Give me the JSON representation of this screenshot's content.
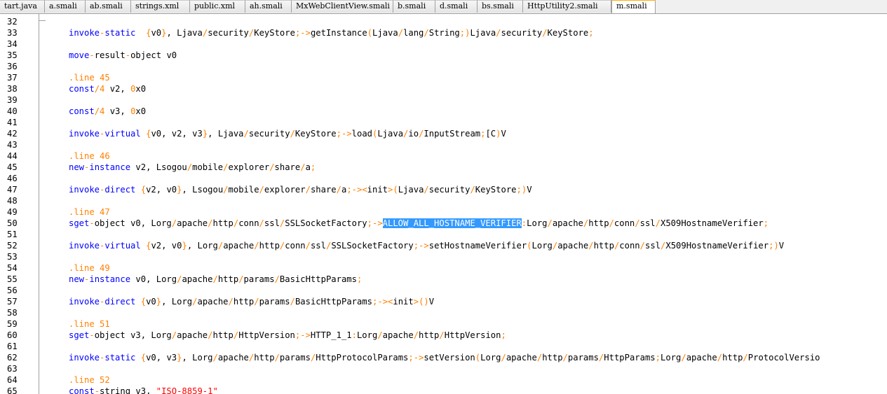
{
  "tabs": [
    {
      "label": "tart.java",
      "active": false
    },
    {
      "label": "a.smali",
      "active": false
    },
    {
      "label": "ab.smali",
      "active": false
    },
    {
      "label": "strings.xml",
      "active": false
    },
    {
      "label": "public.xml",
      "active": false
    },
    {
      "label": "ah.smali",
      "active": false
    },
    {
      "label": "MxWebClientView.smali",
      "active": false
    },
    {
      "label": "b.smali",
      "active": false
    },
    {
      "label": "d.smali",
      "active": false
    },
    {
      "label": "bs.smali",
      "active": false
    },
    {
      "label": "HttpUtility2.smali",
      "active": false
    },
    {
      "label": "m.smali",
      "active": true
    }
  ],
  "selection": "ALLOW_ALL_HOSTNAME_VERIFIER",
  "lines": [
    {
      "n": "32",
      "tokens": []
    },
    {
      "n": "33",
      "tokens": [
        [
          "kw",
          "invoke"
        ],
        [
          "op",
          "-"
        ],
        [
          "kw",
          "static"
        ],
        [
          "",
          "  "
        ],
        [
          "op",
          "{"
        ],
        [
          "",
          "v0"
        ],
        [
          "op",
          "}"
        ],
        [
          "",
          ", Ljava"
        ],
        [
          "op",
          "/"
        ],
        [
          "",
          "security"
        ],
        [
          "op",
          "/"
        ],
        [
          "",
          "KeyStore"
        ],
        [
          "op",
          ";->"
        ],
        [
          "",
          "getInstance"
        ],
        [
          "op",
          "("
        ],
        [
          "",
          "Ljava"
        ],
        [
          "op",
          "/"
        ],
        [
          "",
          "lang"
        ],
        [
          "op",
          "/"
        ],
        [
          "",
          "String"
        ],
        [
          "op",
          ";)"
        ],
        [
          "",
          "Ljava"
        ],
        [
          "op",
          "/"
        ],
        [
          "",
          "security"
        ],
        [
          "op",
          "/"
        ],
        [
          "",
          "KeyStore"
        ],
        [
          "op",
          ";"
        ]
      ]
    },
    {
      "n": "34",
      "tokens": []
    },
    {
      "n": "35",
      "tokens": [
        [
          "kw",
          "move"
        ],
        [
          "op",
          "-"
        ],
        [
          "",
          "result"
        ],
        [
          "op",
          "-"
        ],
        [
          "",
          "object v0"
        ]
      ]
    },
    {
      "n": "36",
      "tokens": []
    },
    {
      "n": "37",
      "tokens": [
        [
          "dir",
          ".line"
        ],
        [
          "",
          " "
        ],
        [
          "num",
          "45"
        ]
      ]
    },
    {
      "n": "38",
      "tokens": [
        [
          "kw",
          "const"
        ],
        [
          "op",
          "/"
        ],
        [
          "num",
          "4"
        ],
        [
          "",
          " v2, "
        ],
        [
          "num",
          "0"
        ],
        [
          "",
          "x0"
        ]
      ]
    },
    {
      "n": "39",
      "tokens": []
    },
    {
      "n": "40",
      "tokens": [
        [
          "kw",
          "const"
        ],
        [
          "op",
          "/"
        ],
        [
          "num",
          "4"
        ],
        [
          "",
          " v3, "
        ],
        [
          "num",
          "0"
        ],
        [
          "",
          "x0"
        ]
      ]
    },
    {
      "n": "41",
      "tokens": []
    },
    {
      "n": "42",
      "tokens": [
        [
          "kw",
          "invoke"
        ],
        [
          "op",
          "-"
        ],
        [
          "kw",
          "virtual"
        ],
        [
          "",
          " "
        ],
        [
          "op",
          "{"
        ],
        [
          "",
          "v0, v2, v3"
        ],
        [
          "op",
          "}"
        ],
        [
          "",
          ", Ljava"
        ],
        [
          "op",
          "/"
        ],
        [
          "",
          "security"
        ],
        [
          "op",
          "/"
        ],
        [
          "",
          "KeyStore"
        ],
        [
          "op",
          ";->"
        ],
        [
          "",
          "load"
        ],
        [
          "op",
          "("
        ],
        [
          "",
          "Ljava"
        ],
        [
          "op",
          "/"
        ],
        [
          "",
          "io"
        ],
        [
          "op",
          "/"
        ],
        [
          "",
          "InputStream"
        ],
        [
          "op",
          ";"
        ],
        [
          "",
          "[C"
        ],
        [
          "op",
          ")"
        ],
        [
          "",
          "V"
        ]
      ]
    },
    {
      "n": "43",
      "tokens": []
    },
    {
      "n": "44",
      "tokens": [
        [
          "dir",
          ".line"
        ],
        [
          "",
          " "
        ],
        [
          "num",
          "46"
        ]
      ]
    },
    {
      "n": "45",
      "tokens": [
        [
          "kw",
          "new"
        ],
        [
          "op",
          "-"
        ],
        [
          "kw",
          "instance"
        ],
        [
          "",
          " v2, Lsogou"
        ],
        [
          "op",
          "/"
        ],
        [
          "",
          "mobile"
        ],
        [
          "op",
          "/"
        ],
        [
          "",
          "explorer"
        ],
        [
          "op",
          "/"
        ],
        [
          "",
          "share"
        ],
        [
          "op",
          "/"
        ],
        [
          "",
          "a"
        ],
        [
          "op",
          ";"
        ]
      ]
    },
    {
      "n": "46",
      "tokens": []
    },
    {
      "n": "47",
      "tokens": [
        [
          "kw",
          "invoke"
        ],
        [
          "op",
          "-"
        ],
        [
          "kw",
          "direct"
        ],
        [
          "",
          " "
        ],
        [
          "op",
          "{"
        ],
        [
          "",
          "v2, v0"
        ],
        [
          "op",
          "}"
        ],
        [
          "",
          ", Lsogou"
        ],
        [
          "op",
          "/"
        ],
        [
          "",
          "mobile"
        ],
        [
          "op",
          "/"
        ],
        [
          "",
          "explorer"
        ],
        [
          "op",
          "/"
        ],
        [
          "",
          "share"
        ],
        [
          "op",
          "/"
        ],
        [
          "",
          "a"
        ],
        [
          "op",
          ";-><"
        ],
        [
          "",
          "init"
        ],
        [
          "op",
          ">("
        ],
        [
          "",
          "Ljava"
        ],
        [
          "op",
          "/"
        ],
        [
          "",
          "security"
        ],
        [
          "op",
          "/"
        ],
        [
          "",
          "KeyStore"
        ],
        [
          "op",
          ";)"
        ],
        [
          "",
          "V"
        ]
      ]
    },
    {
      "n": "48",
      "tokens": []
    },
    {
      "n": "49",
      "tokens": [
        [
          "dir",
          ".line"
        ],
        [
          "",
          " "
        ],
        [
          "num",
          "47"
        ]
      ]
    },
    {
      "n": "50",
      "tokens": [
        [
          "kw",
          "sget"
        ],
        [
          "op",
          "-"
        ],
        [
          "",
          "object v0, Lorg"
        ],
        [
          "op",
          "/"
        ],
        [
          "",
          "apache"
        ],
        [
          "op",
          "/"
        ],
        [
          "",
          "http"
        ],
        [
          "op",
          "/"
        ],
        [
          "",
          "conn"
        ],
        [
          "op",
          "/"
        ],
        [
          "",
          "ssl"
        ],
        [
          "op",
          "/"
        ],
        [
          "",
          "SSLSocketFactory"
        ],
        [
          "op",
          ";->"
        ],
        [
          "hl",
          "ALLOW_ALL_HOSTNAME_VERIFIER"
        ],
        [
          "op",
          ":"
        ],
        [
          "",
          "Lorg"
        ],
        [
          "op",
          "/"
        ],
        [
          "",
          "apache"
        ],
        [
          "op",
          "/"
        ],
        [
          "",
          "http"
        ],
        [
          "op",
          "/"
        ],
        [
          "",
          "conn"
        ],
        [
          "op",
          "/"
        ],
        [
          "",
          "ssl"
        ],
        [
          "op",
          "/"
        ],
        [
          "",
          "X509HostnameVerifier"
        ],
        [
          "op",
          ";"
        ]
      ]
    },
    {
      "n": "51",
      "tokens": []
    },
    {
      "n": "52",
      "tokens": [
        [
          "kw",
          "invoke"
        ],
        [
          "op",
          "-"
        ],
        [
          "kw",
          "virtual"
        ],
        [
          "",
          " "
        ],
        [
          "op",
          "{"
        ],
        [
          "",
          "v2, v0"
        ],
        [
          "op",
          "}"
        ],
        [
          "",
          ", Lorg"
        ],
        [
          "op",
          "/"
        ],
        [
          "",
          "apache"
        ],
        [
          "op",
          "/"
        ],
        [
          "",
          "http"
        ],
        [
          "op",
          "/"
        ],
        [
          "",
          "conn"
        ],
        [
          "op",
          "/"
        ],
        [
          "",
          "ssl"
        ],
        [
          "op",
          "/"
        ],
        [
          "",
          "SSLSocketFactory"
        ],
        [
          "op",
          ";->"
        ],
        [
          "",
          "setHostnameVerifier"
        ],
        [
          "op",
          "("
        ],
        [
          "",
          "Lorg"
        ],
        [
          "op",
          "/"
        ],
        [
          "",
          "apache"
        ],
        [
          "op",
          "/"
        ],
        [
          "",
          "http"
        ],
        [
          "op",
          "/"
        ],
        [
          "",
          "conn"
        ],
        [
          "op",
          "/"
        ],
        [
          "",
          "ssl"
        ],
        [
          "op",
          "/"
        ],
        [
          "",
          "X509HostnameVerifier"
        ],
        [
          "op",
          ";)"
        ],
        [
          "",
          "V"
        ]
      ]
    },
    {
      "n": "53",
      "tokens": []
    },
    {
      "n": "54",
      "tokens": [
        [
          "dir",
          ".line"
        ],
        [
          "",
          " "
        ],
        [
          "num",
          "49"
        ]
      ]
    },
    {
      "n": "55",
      "tokens": [
        [
          "kw",
          "new"
        ],
        [
          "op",
          "-"
        ],
        [
          "kw",
          "instance"
        ],
        [
          "",
          " v0, Lorg"
        ],
        [
          "op",
          "/"
        ],
        [
          "",
          "apache"
        ],
        [
          "op",
          "/"
        ],
        [
          "",
          "http"
        ],
        [
          "op",
          "/"
        ],
        [
          "",
          "params"
        ],
        [
          "op",
          "/"
        ],
        [
          "",
          "BasicHttpParams"
        ],
        [
          "op",
          ";"
        ]
      ]
    },
    {
      "n": "56",
      "tokens": []
    },
    {
      "n": "57",
      "tokens": [
        [
          "kw",
          "invoke"
        ],
        [
          "op",
          "-"
        ],
        [
          "kw",
          "direct"
        ],
        [
          "",
          " "
        ],
        [
          "op",
          "{"
        ],
        [
          "",
          "v0"
        ],
        [
          "op",
          "}"
        ],
        [
          "",
          ", Lorg"
        ],
        [
          "op",
          "/"
        ],
        [
          "",
          "apache"
        ],
        [
          "op",
          "/"
        ],
        [
          "",
          "http"
        ],
        [
          "op",
          "/"
        ],
        [
          "",
          "params"
        ],
        [
          "op",
          "/"
        ],
        [
          "",
          "BasicHttpParams"
        ],
        [
          "op",
          ";-><"
        ],
        [
          "",
          "init"
        ],
        [
          "op",
          ">()"
        ],
        [
          "",
          "V"
        ]
      ]
    },
    {
      "n": "58",
      "tokens": []
    },
    {
      "n": "59",
      "tokens": [
        [
          "dir",
          ".line"
        ],
        [
          "",
          " "
        ],
        [
          "num",
          "51"
        ]
      ]
    },
    {
      "n": "60",
      "tokens": [
        [
          "kw",
          "sget"
        ],
        [
          "op",
          "-"
        ],
        [
          "",
          "object v3, Lorg"
        ],
        [
          "op",
          "/"
        ],
        [
          "",
          "apache"
        ],
        [
          "op",
          "/"
        ],
        [
          "",
          "http"
        ],
        [
          "op",
          "/"
        ],
        [
          "",
          "HttpVersion"
        ],
        [
          "op",
          ";->"
        ],
        [
          "",
          "HTTP_1_1"
        ],
        [
          "op",
          ":"
        ],
        [
          "",
          "Lorg"
        ],
        [
          "op",
          "/"
        ],
        [
          "",
          "apache"
        ],
        [
          "op",
          "/"
        ],
        [
          "",
          "http"
        ],
        [
          "op",
          "/"
        ],
        [
          "",
          "HttpVersion"
        ],
        [
          "op",
          ";"
        ]
      ]
    },
    {
      "n": "61",
      "tokens": []
    },
    {
      "n": "62",
      "tokens": [
        [
          "kw",
          "invoke"
        ],
        [
          "op",
          "-"
        ],
        [
          "kw",
          "static"
        ],
        [
          "",
          " "
        ],
        [
          "op",
          "{"
        ],
        [
          "",
          "v0, v3"
        ],
        [
          "op",
          "}"
        ],
        [
          "",
          ", Lorg"
        ],
        [
          "op",
          "/"
        ],
        [
          "",
          "apache"
        ],
        [
          "op",
          "/"
        ],
        [
          "",
          "http"
        ],
        [
          "op",
          "/"
        ],
        [
          "",
          "params"
        ],
        [
          "op",
          "/"
        ],
        [
          "",
          "HttpProtocolParams"
        ],
        [
          "op",
          ";->"
        ],
        [
          "",
          "setVersion"
        ],
        [
          "op",
          "("
        ],
        [
          "",
          "Lorg"
        ],
        [
          "op",
          "/"
        ],
        [
          "",
          "apache"
        ],
        [
          "op",
          "/"
        ],
        [
          "",
          "http"
        ],
        [
          "op",
          "/"
        ],
        [
          "",
          "params"
        ],
        [
          "op",
          "/"
        ],
        [
          "",
          "HttpParams"
        ],
        [
          "op",
          ";"
        ],
        [
          "",
          "Lorg"
        ],
        [
          "op",
          "/"
        ],
        [
          "",
          "apache"
        ],
        [
          "op",
          "/"
        ],
        [
          "",
          "http"
        ],
        [
          "op",
          "/"
        ],
        [
          "",
          "ProtocolVersio"
        ]
      ]
    },
    {
      "n": "63",
      "tokens": []
    },
    {
      "n": "64",
      "tokens": [
        [
          "dir",
          ".line"
        ],
        [
          "",
          " "
        ],
        [
          "num",
          "52"
        ]
      ]
    },
    {
      "n": "65",
      "tokens": [
        [
          "kw",
          "const"
        ],
        [
          "op",
          "-"
        ],
        [
          "",
          "string v3, "
        ],
        [
          "str",
          "\"ISO-8859-1\""
        ]
      ]
    }
  ]
}
